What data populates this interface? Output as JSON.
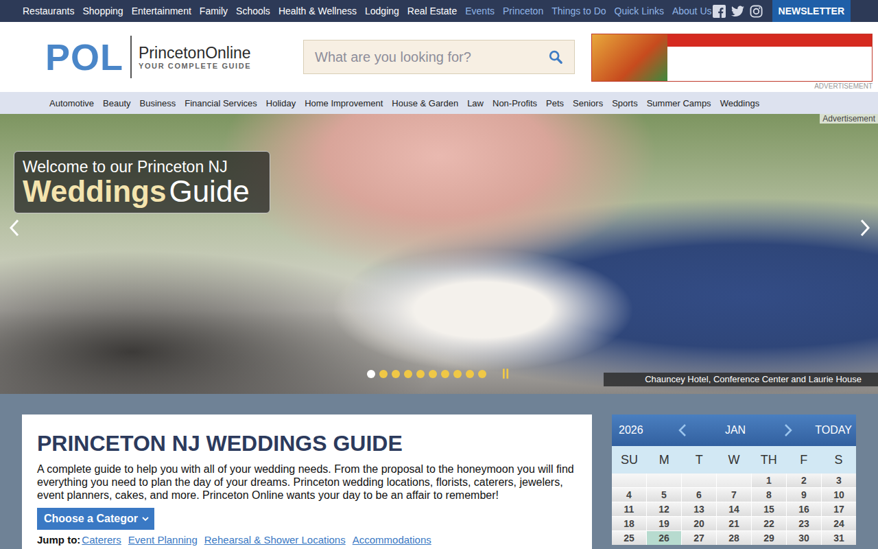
{
  "top_nav": {
    "primary": [
      "Restaurants",
      "Shopping",
      "Entertainment",
      "Family",
      "Schools",
      "Health & Wellness",
      "Lodging",
      "Real Estate"
    ],
    "secondary": [
      "Events",
      "Princeton",
      "Things to Do",
      "Quick Links",
      "About Us"
    ],
    "newsletter": "NEWSLETTER"
  },
  "logo": {
    "mark": "POL",
    "name": "PrincetonOnline",
    "tagline": "YOUR COMPLETE GUIDE"
  },
  "search": {
    "placeholder": "What are you looking for?"
  },
  "ad": {
    "label": "ADVERTISEMENT"
  },
  "category_nav": [
    "Automotive",
    "Beauty",
    "Business",
    "Financial Services",
    "Holiday",
    "Home Improvement",
    "House & Garden",
    "Law",
    "Non-Profits",
    "Pets",
    "Seniors",
    "Sports",
    "Summer Camps",
    "Weddings"
  ],
  "hero": {
    "ad_label": "Advertisement",
    "welcome": "Welcome to our Princeton NJ",
    "title_bold": "Weddings",
    "title_light": "Guide",
    "caption": "Chauncey Hotel, Conference Center and Laurie House",
    "slides": [
      {
        "selected": true
      },
      {
        "selected": false
      },
      {
        "selected": false
      },
      {
        "selected": false
      },
      {
        "selected": false
      },
      {
        "selected": false
      },
      {
        "selected": false
      },
      {
        "selected": false
      },
      {
        "selected": false
      },
      {
        "selected": false
      }
    ]
  },
  "guide": {
    "title": "PRINCETON NJ WEDDINGS GUIDE",
    "description": "A complete guide to help you with all of your wedding needs. From the proposal to the honeymoon you will find everything you need to plan the day of your dreams. Princeton wedding locations, florists, caterers, jewelers, event planners, cakes, and more. Princeton Online wants your day to be an affair to remember!",
    "select": "Choose a Categor",
    "jump_label": "Jump to:",
    "jump_links": [
      "Caterers",
      "Event Planning",
      "Rehearsal & Shower Locations",
      "Accommodations"
    ]
  },
  "calendar": {
    "year": "2026",
    "month": "JAN",
    "today": "TODAY",
    "weekdays": [
      "SU",
      "M",
      "T",
      "W",
      "TH",
      "F",
      "S"
    ],
    "weeks": [
      [
        {
          "day": "",
          "selected": false
        },
        {
          "day": "",
          "selected": false
        },
        {
          "day": "",
          "selected": false
        },
        {
          "day": "",
          "selected": false
        },
        {
          "day": "1",
          "selected": false
        },
        {
          "day": "2",
          "selected": false
        },
        {
          "day": "3",
          "selected": false
        }
      ],
      [
        {
          "day": "4",
          "selected": false
        },
        {
          "day": "5",
          "selected": false
        },
        {
          "day": "6",
          "selected": false
        },
        {
          "day": "7",
          "selected": false
        },
        {
          "day": "8",
          "selected": false
        },
        {
          "day": "9",
          "selected": false
        },
        {
          "day": "10",
          "selected": false
        }
      ],
      [
        {
          "day": "11",
          "selected": false
        },
        {
          "day": "12",
          "selected": false
        },
        {
          "day": "13",
          "selected": false
        },
        {
          "day": "14",
          "selected": false
        },
        {
          "day": "15",
          "selected": false
        },
        {
          "day": "16",
          "selected": false
        },
        {
          "day": "17",
          "selected": false
        }
      ],
      [
        {
          "day": "18",
          "selected": false
        },
        {
          "day": "19",
          "selected": false
        },
        {
          "day": "20",
          "selected": false
        },
        {
          "day": "21",
          "selected": false
        },
        {
          "day": "22",
          "selected": false
        },
        {
          "day": "23",
          "selected": false
        },
        {
          "day": "24",
          "selected": false
        }
      ],
      [
        {
          "day": "25",
          "selected": false
        },
        {
          "day": "26",
          "selected": true
        },
        {
          "day": "27",
          "selected": false
        },
        {
          "day": "28",
          "selected": false
        },
        {
          "day": "29",
          "selected": false
        },
        {
          "day": "30",
          "selected": false
        },
        {
          "day": "31",
          "selected": false
        }
      ]
    ]
  }
}
